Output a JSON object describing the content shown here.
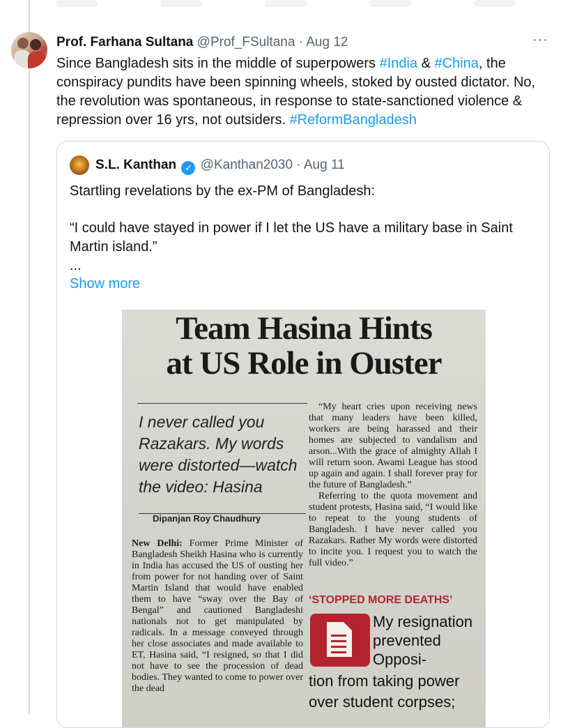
{
  "tweet": {
    "author_name": "Prof. Farhana Sultana",
    "handle": "@Prof_FSultana",
    "separator": "·",
    "date": "Aug 12",
    "text_parts": [
      "Since Bangladesh sits in the middle of superpowers ",
      "#India",
      " & ",
      "#China",
      ", the conspiracy pundits have been spinning wheels, stoked by ousted dictator. No, the revolution was spontaneous, in response to state-sanctioned violence & repression over 16 yrs, not outsiders. ",
      "#ReformBangladesh"
    ],
    "more_label": "···"
  },
  "quote": {
    "author_name": "S.L. Kanthan",
    "verified_glyph": "✓",
    "handle": "@Kanthan2030",
    "separator": "·",
    "date": "Aug 11",
    "line1": "Startling revelations by the ex-PM of Bangladesh:",
    "line2": "“I could have stayed in power if I let the US have a military base in Saint Martin island.”",
    "ellipsis": "...",
    "show_more": "Show more"
  },
  "clipping": {
    "headline_1": "Team Hasina Hints",
    "headline_2": "at US Role in Ouster",
    "deck": "I never called you Razakars. My words were distorted—watch the video: Hasina",
    "byline": "Dipanjan Roy Chaudhury",
    "dateline": "New Delhi:",
    "body_left": " Former Prime Minister of Bangladesh Sheikh Hasina who is currently in India has accused the US of ousting her from power for not handing over of Saint Martin Island that would have enabled them to have “sway over the Bay of Bengal” and cautioned Bangladeshi nationals not to get manipulated by radicals. In a message conveyed through her close associates and made available to ET, Hasina said, “I resigned, so that I did not have to see the procession of dead bodies. They wanted to come to power over the dead",
    "body_right_1": "“My heart cries upon receiving news that many leaders have been killed, workers are being harassed and their homes are subjected to vandalism and arson...With the grace of almighty Allah I will return soon. Awami League has stood up again and again. I shall forever pray for the future of Bangladesh.”",
    "body_right_2": "Referring to the quota movement and student protests, Hasina said, “I would like to repeat to the young students of Bangladesh. I have never called you Razakars. Rather My words were distorted to incite you. I request you to watch the full video.”",
    "subhead": "‘STOPPED MORE DEATHS’",
    "pull_quote_a": "My resignation prevented Opposi-",
    "pull_quote_b": "tion from taking power over student corpses;"
  },
  "colors": {
    "link": "#1d9bf0",
    "muted": "#536471",
    "border": "#cfd9de",
    "accent_red": "#b5232e"
  }
}
